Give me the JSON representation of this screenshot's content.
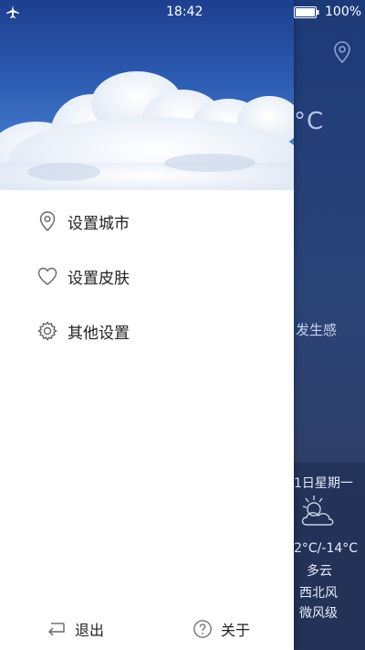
{
  "status_bar": {
    "time": "18:42",
    "battery": "100%"
  },
  "background": {
    "temp_fragment": "°C",
    "feels_fragment": "发生感",
    "date_fragment": "1日星期一",
    "temp_range": "2°C/-14°C",
    "condition": "多云",
    "wind_direction": "西北风",
    "wind_level": "微风级"
  },
  "menu": {
    "items": [
      {
        "label": "设置城市",
        "icon": "location-pin-icon"
      },
      {
        "label": "设置皮肤",
        "icon": "heart-icon"
      },
      {
        "label": "其他设置",
        "icon": "gear-icon"
      }
    ]
  },
  "footer": {
    "exit_label": "退出",
    "about_label": "关于"
  },
  "colors": {
    "drawer_bg": "#ffffff",
    "weather_bg": "#2b4478",
    "text": "#222222"
  }
}
